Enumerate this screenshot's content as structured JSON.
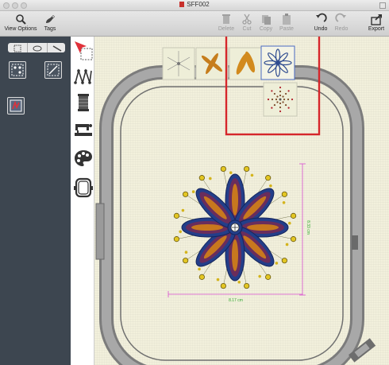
{
  "window": {
    "title": "SFF002"
  },
  "toolbar": {
    "view_options": "View Options",
    "tags": "Tags",
    "delete": "Delete",
    "cut": "Cut",
    "copy": "Copy",
    "paste": "Paste",
    "undo": "Undo",
    "redo": "Redo",
    "export": "Export"
  },
  "design": {
    "width_label": "8.17 cm",
    "height_label": "8.33 cm"
  },
  "colors": {
    "highlight": "#d6262b",
    "left_panel": "#3d4650",
    "hoop": "#8c8c8c",
    "accent_red": "#e0313a"
  },
  "icons": [
    "magnifier-icon",
    "tag-icon",
    "trash-icon",
    "scissors-icon",
    "copy-icon",
    "paste-icon",
    "undo-icon",
    "redo-icon",
    "export-icon",
    "select-arrow-icon",
    "stitch-path-icon",
    "thread-spool-icon",
    "sewing-machine-icon",
    "palette-icon",
    "hoop-icon"
  ]
}
